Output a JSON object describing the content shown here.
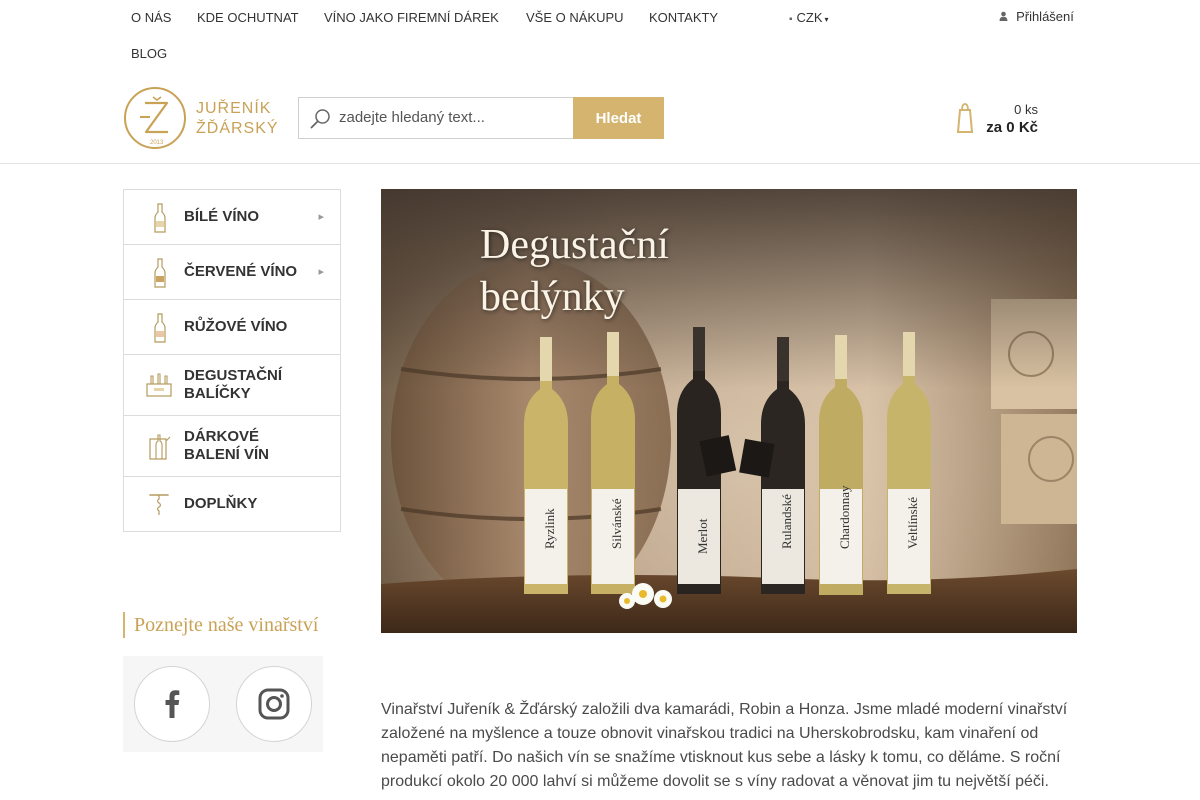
{
  "nav": {
    "items": [
      "O NÁS",
      "KDE OCHUTNAT",
      "VÍNO JAKO FIREMNÍ DÁREK",
      "VŠE O NÁKUPU",
      "KONTAKTY",
      "BLOG"
    ],
    "currency": "CZK",
    "login": "Přihlášení"
  },
  "logo": {
    "line1": "JUŘENÍK",
    "line2": "ŽĎÁRSKÝ",
    "year": "2013"
  },
  "search": {
    "placeholder": "zadejte hledaný text...",
    "button": "Hledat"
  },
  "cart": {
    "count": "0 ks",
    "total": "za 0 Kč"
  },
  "categories": [
    {
      "label": "BÍLÉ VÍNO",
      "icon": "white-wine-bottle-icon",
      "has_submenu": true
    },
    {
      "label": "ČERVENÉ VÍNO",
      "icon": "red-wine-bottle-icon",
      "has_submenu": true
    },
    {
      "label": "RŮŽOVÉ VÍNO",
      "icon": "rose-wine-bottle-icon",
      "has_submenu": false
    },
    {
      "label": "DEGUSTAČNÍ BALÍČKY",
      "icon": "tasting-box-icon",
      "has_submenu": false
    },
    {
      "label": "DÁRKOVÉ BALENÍ VÍN",
      "icon": "gift-box-icon",
      "has_submenu": false
    },
    {
      "label": "DOPLŇKY",
      "icon": "corkscrew-icon",
      "has_submenu": false
    }
  ],
  "sidebar": {
    "winery_title": "Poznejte naše vinařství",
    "social": [
      "facebook-icon",
      "instagram-icon"
    ]
  },
  "banner": {
    "title": "Degustační\nbedýnky",
    "bottle_labels": [
      "Ryzlink",
      "Silvánské",
      "Merlot",
      "Rulandské",
      "Chardonnay",
      "Veltlínské"
    ]
  },
  "intro": {
    "text": "Vinařství Juřeník & Žďárský založili dva kamarádi, Robin a Honza. Jsme mladé moderní vinařství založené na myšlence a touze obnovit vinařskou tradici na Uherskobrodsku, kam vinaření od nepaměti patří. Do našich vín se snažíme vtisknout kus sebe a lásky k tomu, co děláme. S roční produkcí okolo 20 000 lahví si můžeme dovolit se s víny radovat a věnovat jim tu největší péči."
  },
  "colors": {
    "gold": "#d4b46e",
    "gold_text": "#c9a256",
    "border": "#dcdcdc"
  }
}
